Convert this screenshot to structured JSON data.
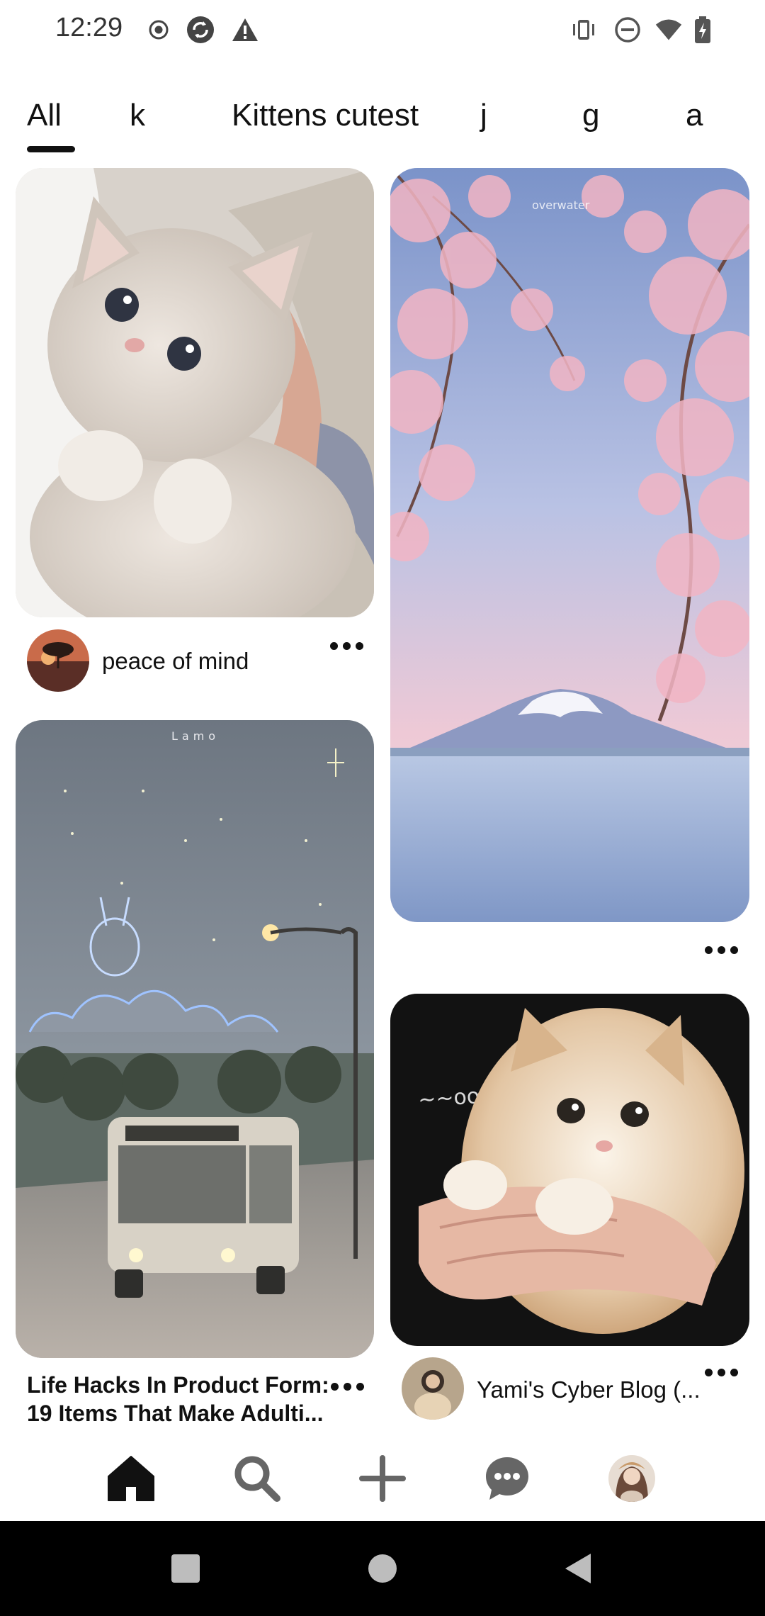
{
  "status_bar": {
    "time": "12:29",
    "left_icons": [
      "record-icon",
      "sync-icon",
      "warning-icon"
    ],
    "right_icons": [
      "vibrate-icon",
      "do-not-disturb-icon",
      "wifi-icon",
      "battery-icon"
    ]
  },
  "tabs": [
    {
      "label": "All",
      "selected": true
    },
    {
      "label": "k"
    },
    {
      "label": "Kittens cutest"
    },
    {
      "label": "j"
    },
    {
      "label": "g"
    },
    {
      "label": "a"
    }
  ],
  "pins": [
    {
      "image": "grey kitten held in arm",
      "title": "peace of mind",
      "has_avatar": true
    },
    {
      "image": "cherry blossoms and Mount Fuji",
      "image_caption": "overwater",
      "title": ""
    },
    {
      "image": "illustrated night bus street scene",
      "image_caption": "Lamo",
      "title_lines": [
        "Life Hacks In Product Form:",
        "19 Items That Make Adulti..."
      ]
    },
    {
      "image": "fluffy cream kitten held by hands",
      "title": "Yami's Cyber Blog (...",
      "has_avatar": true
    }
  ],
  "bottom_nav": [
    {
      "icon": "home-icon",
      "active": true
    },
    {
      "icon": "search-icon"
    },
    {
      "icon": "plus-icon"
    },
    {
      "icon": "chat-icon"
    },
    {
      "icon": "profile-avatar"
    }
  ],
  "colors": {
    "text": "#111111",
    "background": "#ffffff",
    "system_nav": "#000000"
  }
}
